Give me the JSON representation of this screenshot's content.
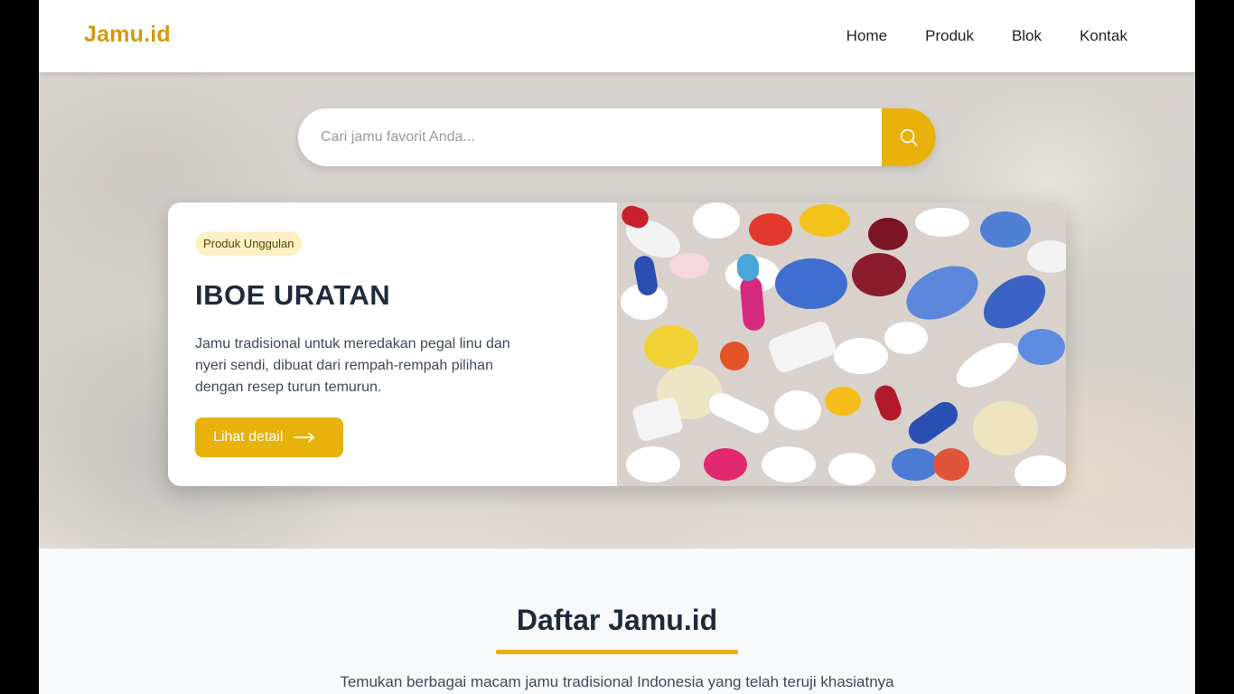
{
  "header": {
    "logo": "Jamu.id",
    "nav": [
      "Home",
      "Produk",
      "Blok",
      "Kontak"
    ]
  },
  "search": {
    "placeholder": "Cari jamu favorit Anda..."
  },
  "featured": {
    "badge": "Produk Unggulan",
    "title": "IBOE URATAN",
    "description": "Jamu tradisional untuk meredakan pegal linu dan nyeri sendi, dibuat dari rempah-rempah pilihan dengan resep turun temurun.",
    "button_label": "Lihat detail"
  },
  "section": {
    "title": "Daftar Jamu.id",
    "subtitle": "Temukan berbagai macam jamu tradisional Indonesia yang telah teruji khasiatnya"
  },
  "icons": {
    "search": "search-icon",
    "arrow": "arrow-right-icon"
  },
  "colors": {
    "accent": "#e9b10c",
    "logo": "#d39a10",
    "badge_bg": "#fdf1c4",
    "heading": "#1e2a3a"
  }
}
